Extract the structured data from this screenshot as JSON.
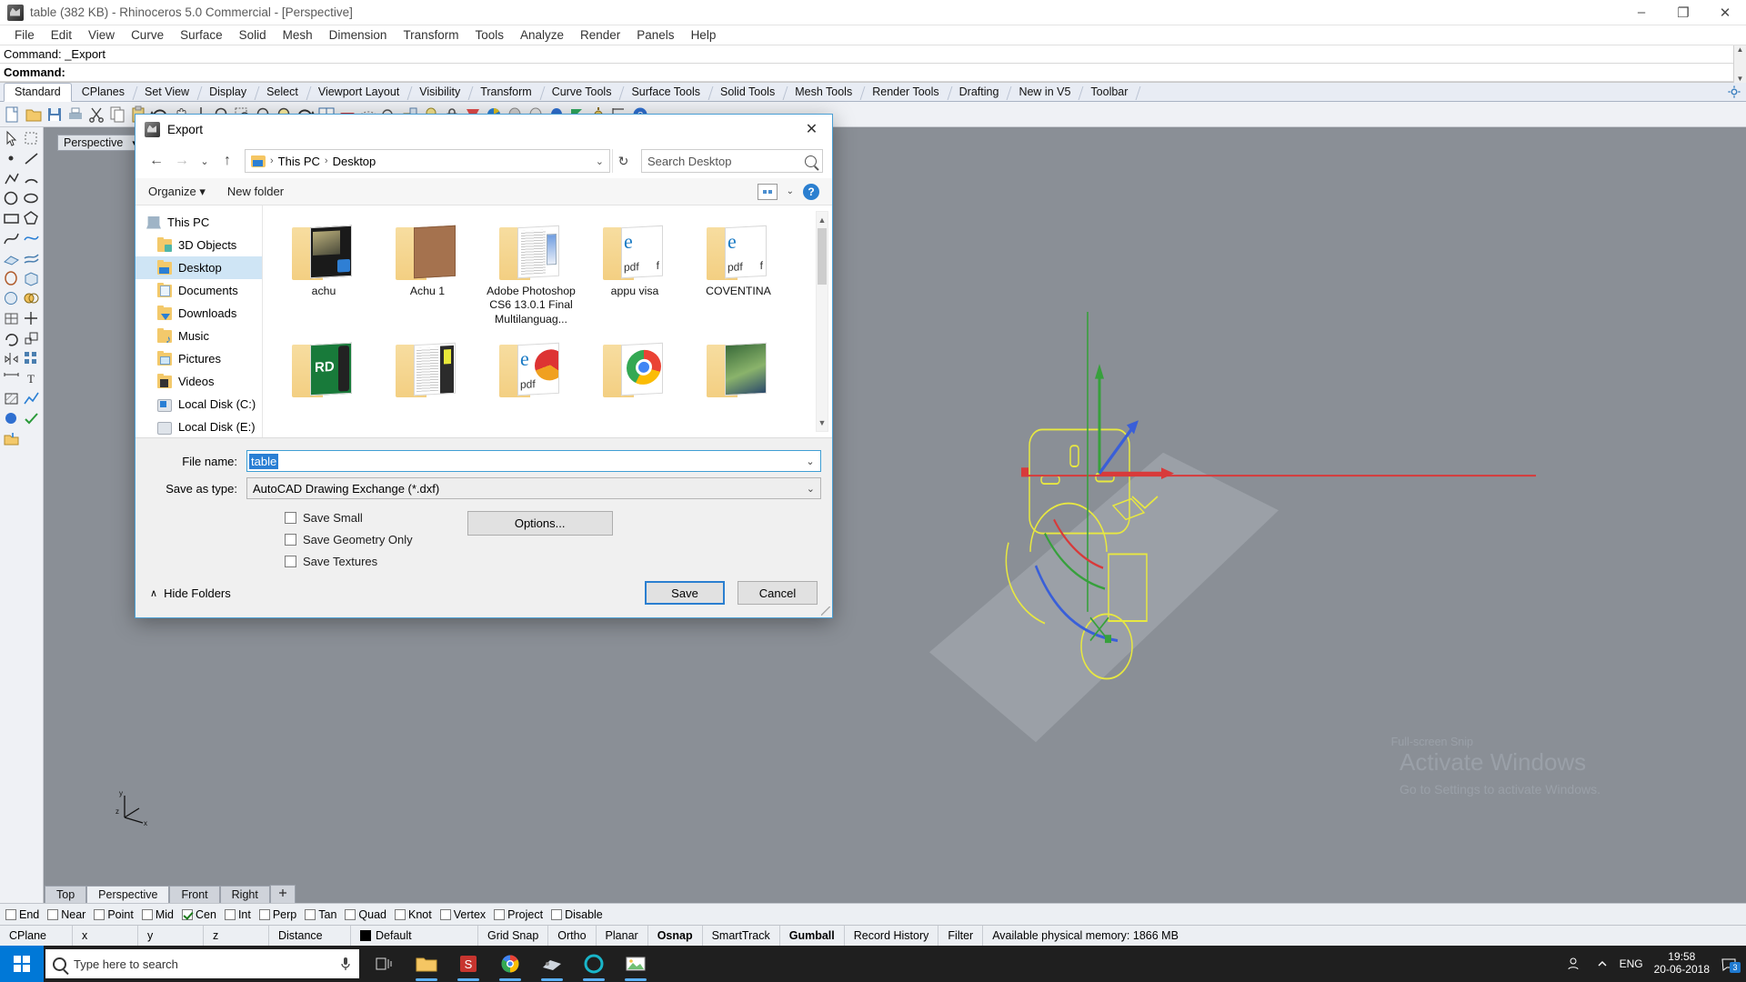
{
  "window": {
    "title": "table (382 KB) - Rhinoceros 5.0 Commercial - [Perspective]",
    "minimize": "–",
    "maximize": "❐",
    "close": "✕"
  },
  "menu": [
    "File",
    "Edit",
    "View",
    "Curve",
    "Surface",
    "Solid",
    "Mesh",
    "Dimension",
    "Transform",
    "Tools",
    "Analyze",
    "Render",
    "Panels",
    "Help"
  ],
  "command": {
    "line1": "Command: _Export",
    "line2": "Command:"
  },
  "toolbar_tabs": [
    "Standard",
    "CPlanes",
    "Set View",
    "Display",
    "Select",
    "Viewport Layout",
    "Visibility",
    "Transform",
    "Curve Tools",
    "Surface Tools",
    "Solid Tools",
    "Mesh Tools",
    "Render Tools",
    "Drafting",
    "New in V5",
    "Toolbar"
  ],
  "toolbar_active": "Standard",
  "viewport": {
    "label": "Perspective",
    "caret": "▾",
    "axis_x": "x",
    "axis_y": "y",
    "axis_z": "z"
  },
  "viewport_tabs": [
    "Top",
    "Perspective",
    "Front",
    "Right"
  ],
  "viewport_active": "Perspective",
  "osnap": [
    {
      "label": "End",
      "checked": false
    },
    {
      "label": "Near",
      "checked": false
    },
    {
      "label": "Point",
      "checked": false
    },
    {
      "label": "Mid",
      "checked": false
    },
    {
      "label": "Cen",
      "checked": true
    },
    {
      "label": "Int",
      "checked": false
    },
    {
      "label": "Perp",
      "checked": false
    },
    {
      "label": "Tan",
      "checked": false
    },
    {
      "label": "Quad",
      "checked": false
    },
    {
      "label": "Knot",
      "checked": false
    },
    {
      "label": "Vertex",
      "checked": false
    },
    {
      "label": "Project",
      "checked": false
    },
    {
      "label": "Disable",
      "checked": false
    }
  ],
  "statusbar": {
    "cplane": "CPlane",
    "x": "x",
    "y": "y",
    "z": "z",
    "distance": "Distance",
    "layer": "Default",
    "grid_snap": "Grid Snap",
    "ortho": "Ortho",
    "planar": "Planar",
    "osnap": "Osnap",
    "smarttrack": "SmartTrack",
    "gumball": "Gumball",
    "record_history": "Record History",
    "filter": "Filter",
    "memory": "Available physical memory: 1866 MB"
  },
  "watermark": {
    "line1": "Activate Windows",
    "line2": "Go to Settings to activate Windows.",
    "snip": "Full-screen Snip"
  },
  "taskbar": {
    "search_placeholder": "Type here to search",
    "language": "ENG",
    "time": "19:58",
    "date": "20-06-2018",
    "notification_count": "3"
  },
  "dialog": {
    "title": "Export",
    "close": "✕",
    "nav": {
      "back": "←",
      "forward": "→",
      "recent": "⌄",
      "up": "↑",
      "refresh": "↻",
      "dropdown": "⌄"
    },
    "breadcrumb": [
      "This PC",
      "Desktop"
    ],
    "breadcrumb_sep": "›",
    "search": {
      "placeholder": "Search Desktop"
    },
    "commands": {
      "organize": "Organize",
      "organize_caret": "▾",
      "new_folder": "New folder",
      "help": "?"
    },
    "tree": [
      {
        "label": "This PC",
        "icon": "pc-icon",
        "root": true,
        "selected": false
      },
      {
        "label": "3D Objects",
        "icon": "folder-3d-objects-icon",
        "root": false,
        "selected": false
      },
      {
        "label": "Desktop",
        "icon": "folder-desktop-icon",
        "root": false,
        "selected": true
      },
      {
        "label": "Documents",
        "icon": "folder-documents-icon",
        "root": false,
        "selected": false
      },
      {
        "label": "Downloads",
        "icon": "folder-downloads-icon",
        "root": false,
        "selected": false
      },
      {
        "label": "Music",
        "icon": "folder-music-icon",
        "root": false,
        "selected": false
      },
      {
        "label": "Pictures",
        "icon": "folder-pictures-icon",
        "root": false,
        "selected": false
      },
      {
        "label": "Videos",
        "icon": "folder-videos-icon",
        "root": false,
        "selected": false
      },
      {
        "label": "Local Disk (C:)",
        "icon": "drive-system-icon",
        "root": false,
        "selected": false
      },
      {
        "label": "Local Disk (E:)",
        "icon": "drive-icon",
        "root": false,
        "selected": false
      }
    ],
    "files": [
      {
        "label": "achu",
        "thumb": "photo"
      },
      {
        "label": "Achu 1",
        "thumb": "brown"
      },
      {
        "label": "Adobe Photoshop CS6 13.0.1 Final Multilanguag...",
        "thumb": "docs"
      },
      {
        "label": "appu visa",
        "thumb": "pdf"
      },
      {
        "label": "COVENTINA",
        "thumb": "pdf"
      },
      {
        "label": "",
        "thumb": "green"
      },
      {
        "label": "",
        "thumb": "dark"
      },
      {
        "label": "",
        "thumb": "pdf2"
      },
      {
        "label": "",
        "thumb": "chrome"
      },
      {
        "label": "",
        "thumb": "photo2"
      }
    ],
    "form": {
      "file_name_label": "File name:",
      "file_name_value": "table",
      "save_as_type_label": "Save as type:",
      "save_as_type_value": "AutoCAD Drawing Exchange (*.dxf)",
      "dropdown_caret": "⌄"
    },
    "options": [
      {
        "label": "Save Small",
        "checked": false
      },
      {
        "label": "Save Geometry Only",
        "checked": false
      },
      {
        "label": "Save Textures",
        "checked": false
      }
    ],
    "options_button": "Options...",
    "footer": {
      "hide_folders": "Hide Folders",
      "chevron": "∧",
      "save": "Save",
      "cancel": "Cancel"
    }
  },
  "colors": {
    "accent": "#2b7fd0",
    "selection": "#2a7fd4",
    "dialog_border": "#4a9fd4",
    "taskbar": "#1f1f1f"
  }
}
